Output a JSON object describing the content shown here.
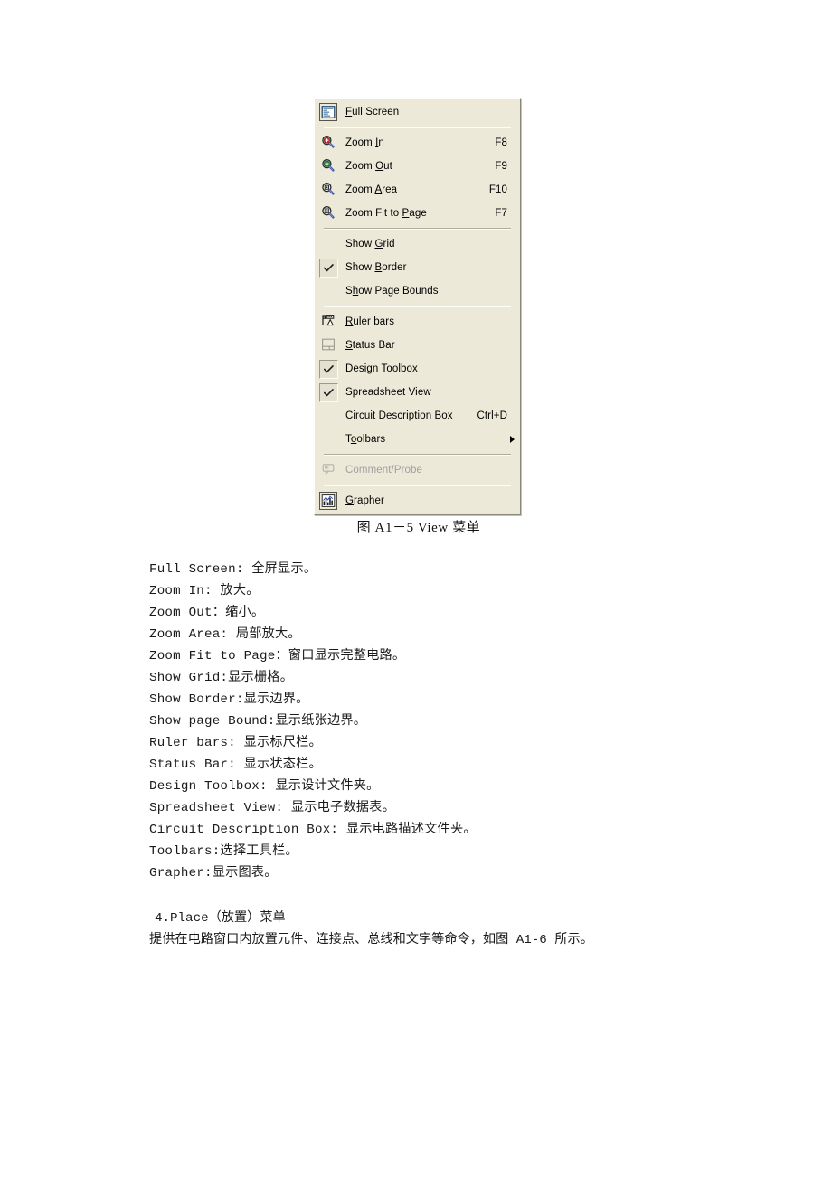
{
  "menu": {
    "title": "View",
    "background_color": "#ece9d8",
    "items": [
      {
        "id": "full-screen",
        "label": "Full Screen",
        "accel": "",
        "icon": "full-screen-icon",
        "checked": false,
        "disabled": false,
        "submenu": false,
        "underline_index": 0
      },
      {
        "id": "separator-1",
        "type": "separator"
      },
      {
        "id": "zoom-in",
        "label": "Zoom In",
        "accel": "F8",
        "icon": "zoom-in-icon",
        "checked": false,
        "disabled": false,
        "submenu": false,
        "underline_index": 5
      },
      {
        "id": "zoom-out",
        "label": "Zoom Out",
        "accel": "F9",
        "icon": "zoom-out-icon",
        "checked": false,
        "disabled": false,
        "submenu": false,
        "underline_index": 5
      },
      {
        "id": "zoom-area",
        "label": "Zoom Area",
        "accel": "F10",
        "icon": "zoom-area-icon",
        "checked": false,
        "disabled": false,
        "submenu": false,
        "underline_index": 5
      },
      {
        "id": "zoom-fit-to-page",
        "label": "Zoom Fit to Page",
        "accel": "F7",
        "icon": "zoom-fit-icon",
        "checked": false,
        "disabled": false,
        "submenu": false,
        "underline_index": 12
      },
      {
        "id": "separator-2",
        "type": "separator"
      },
      {
        "id": "show-grid",
        "label": "Show Grid",
        "accel": "",
        "icon": "",
        "checked": false,
        "disabled": false,
        "submenu": false,
        "underline_index": 5
      },
      {
        "id": "show-border",
        "label": "Show Border",
        "accel": "",
        "icon": "",
        "checked": true,
        "disabled": false,
        "submenu": false,
        "underline_index": 5
      },
      {
        "id": "show-page-bounds",
        "label": "Show Page Bounds",
        "accel": "",
        "icon": "",
        "checked": false,
        "disabled": false,
        "submenu": false,
        "underline_index": 1
      },
      {
        "id": "separator-3",
        "type": "separator"
      },
      {
        "id": "ruler-bars",
        "label": "Ruler bars",
        "accel": "",
        "icon": "ruler-bars-icon",
        "checked": false,
        "disabled": false,
        "submenu": false,
        "underline_index": 0
      },
      {
        "id": "status-bar",
        "label": "Status Bar",
        "accel": "",
        "icon": "status-bar-icon",
        "checked": false,
        "disabled": false,
        "submenu": false,
        "underline_index": 0
      },
      {
        "id": "design-toolbox",
        "label": "Design Toolbox",
        "accel": "",
        "icon": "",
        "checked": true,
        "disabled": false,
        "submenu": false,
        "underline_index": -1
      },
      {
        "id": "spreadsheet-view",
        "label": "Spreadsheet View",
        "accel": "",
        "icon": "",
        "checked": true,
        "disabled": false,
        "submenu": false,
        "underline_index": -1
      },
      {
        "id": "circuit-description-box",
        "label": "Circuit Description Box",
        "accel": "Ctrl+D",
        "icon": "",
        "checked": false,
        "disabled": false,
        "submenu": false,
        "underline_index": -1
      },
      {
        "id": "toolbars",
        "label": "Toolbars",
        "accel": "",
        "icon": "",
        "checked": false,
        "disabled": false,
        "submenu": true,
        "underline_index": 1
      },
      {
        "id": "separator-4",
        "type": "separator"
      },
      {
        "id": "comment-probe",
        "label": "Comment/Probe",
        "accel": "",
        "icon": "comment-probe-icon",
        "checked": false,
        "disabled": true,
        "submenu": false,
        "underline_index": -1
      },
      {
        "id": "separator-5",
        "type": "separator"
      },
      {
        "id": "grapher",
        "label": "Grapher",
        "accel": "",
        "icon": "grapher-icon",
        "checked": false,
        "disabled": false,
        "submenu": false,
        "underline_index": 0
      }
    ]
  },
  "figure": {
    "caption": "图 A1－5  View 菜单"
  },
  "descriptions": [
    "Full Screen: 全屏显示。",
    "Zoom In: 放大。",
    "Zoom Out：缩小。",
    "Zoom Area: 局部放大。",
    "Zoom Fit to Page：窗口显示完整电路。",
    "Show Grid:显示栅格。",
    "Show Border:显示边界。",
    "Show page Bound:显示纸张边界。",
    "Ruler bars: 显示标尺栏。",
    "Status Bar: 显示状态栏。",
    "Design Toolbox: 显示设计文件夹。",
    "Spreadsheet View: 显示电子数据表。",
    "Circuit Description Box: 显示电路描述文件夹。",
    "Toolbars:选择工具栏。",
    "Grapher:显示图表。"
  ],
  "section": {
    "heading": "4.Place（放置）菜单",
    "paragraph": "提供在电路窗口内放置元件、连接点、总线和文字等命令，如图 A1-6 所示。"
  }
}
